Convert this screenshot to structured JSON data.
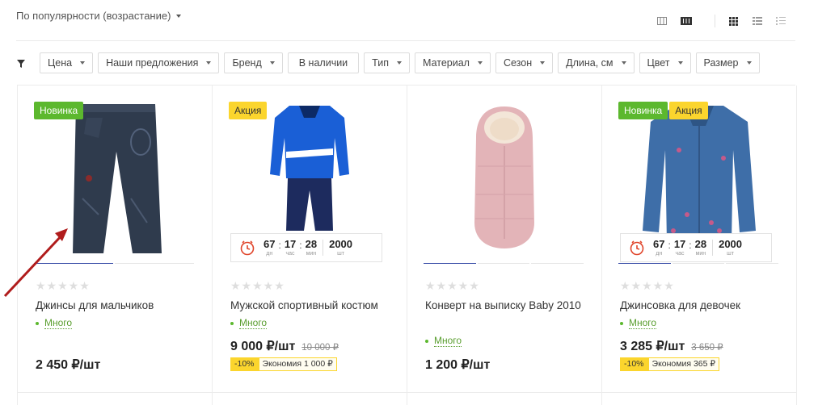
{
  "sort": {
    "label": "По популярности (возрастание)"
  },
  "view_icons": [
    "list-view-icon",
    "compact-view-icon",
    "grid-view-icon",
    "list-icon",
    "table-icon"
  ],
  "filters": [
    {
      "label": "Цена",
      "dropdown": true
    },
    {
      "label": "Наши предложения",
      "dropdown": true
    },
    {
      "label": "Бренд",
      "dropdown": true
    },
    {
      "label": "В наличии",
      "dropdown": false
    },
    {
      "label": "Тип",
      "dropdown": true
    },
    {
      "label": "Материал",
      "dropdown": true
    },
    {
      "label": "Сезон",
      "dropdown": true
    },
    {
      "label": "Длина, см",
      "dropdown": true
    },
    {
      "label": "Цвет",
      "dropdown": true
    },
    {
      "label": "Размер",
      "dropdown": true
    }
  ],
  "products": [
    {
      "badges": [
        "Новинка"
      ],
      "name": "Джинсы для мальчиков",
      "stock": "Много",
      "price": "2 450 ₽/шт",
      "old_price": "",
      "discount": "",
      "saving": ""
    },
    {
      "badges": [
        "Акция"
      ],
      "name": "Мужской спортивный костюм",
      "stock": "Много",
      "price": "9 000 ₽/шт",
      "old_price": "10 000 ₽",
      "discount": "-10%",
      "saving": "Экономия 1 000 ₽",
      "timer": {
        "days": "67",
        "hours": "17",
        "minutes": "28",
        "qty": "2000"
      }
    },
    {
      "badges": [],
      "name": "Конверт на выписку Baby 2010",
      "stock": "Много",
      "price": "1 200 ₽/шт",
      "old_price": "",
      "discount": "",
      "saving": ""
    },
    {
      "badges": [
        "Новинка",
        "Акция"
      ],
      "name": "Джинсовка для девочек",
      "stock": "Много",
      "price": "3 285 ₽/шт",
      "old_price": "3 650 ₽",
      "discount": "-10%",
      "saving": "Экономия 365 ₽",
      "timer": {
        "days": "67",
        "hours": "17",
        "minutes": "28",
        "qty": "2000"
      }
    }
  ],
  "timer_labels": {
    "days": "дн",
    "hours": "час",
    "minutes": "мин",
    "qty": "шт"
  },
  "rating_stars": "★★★★★",
  "colors": {
    "accent": "#3a4fa8",
    "new_badge": "#5cb82e",
    "sale_badge": "#fbd52d",
    "arrow": "#b01c1c"
  }
}
